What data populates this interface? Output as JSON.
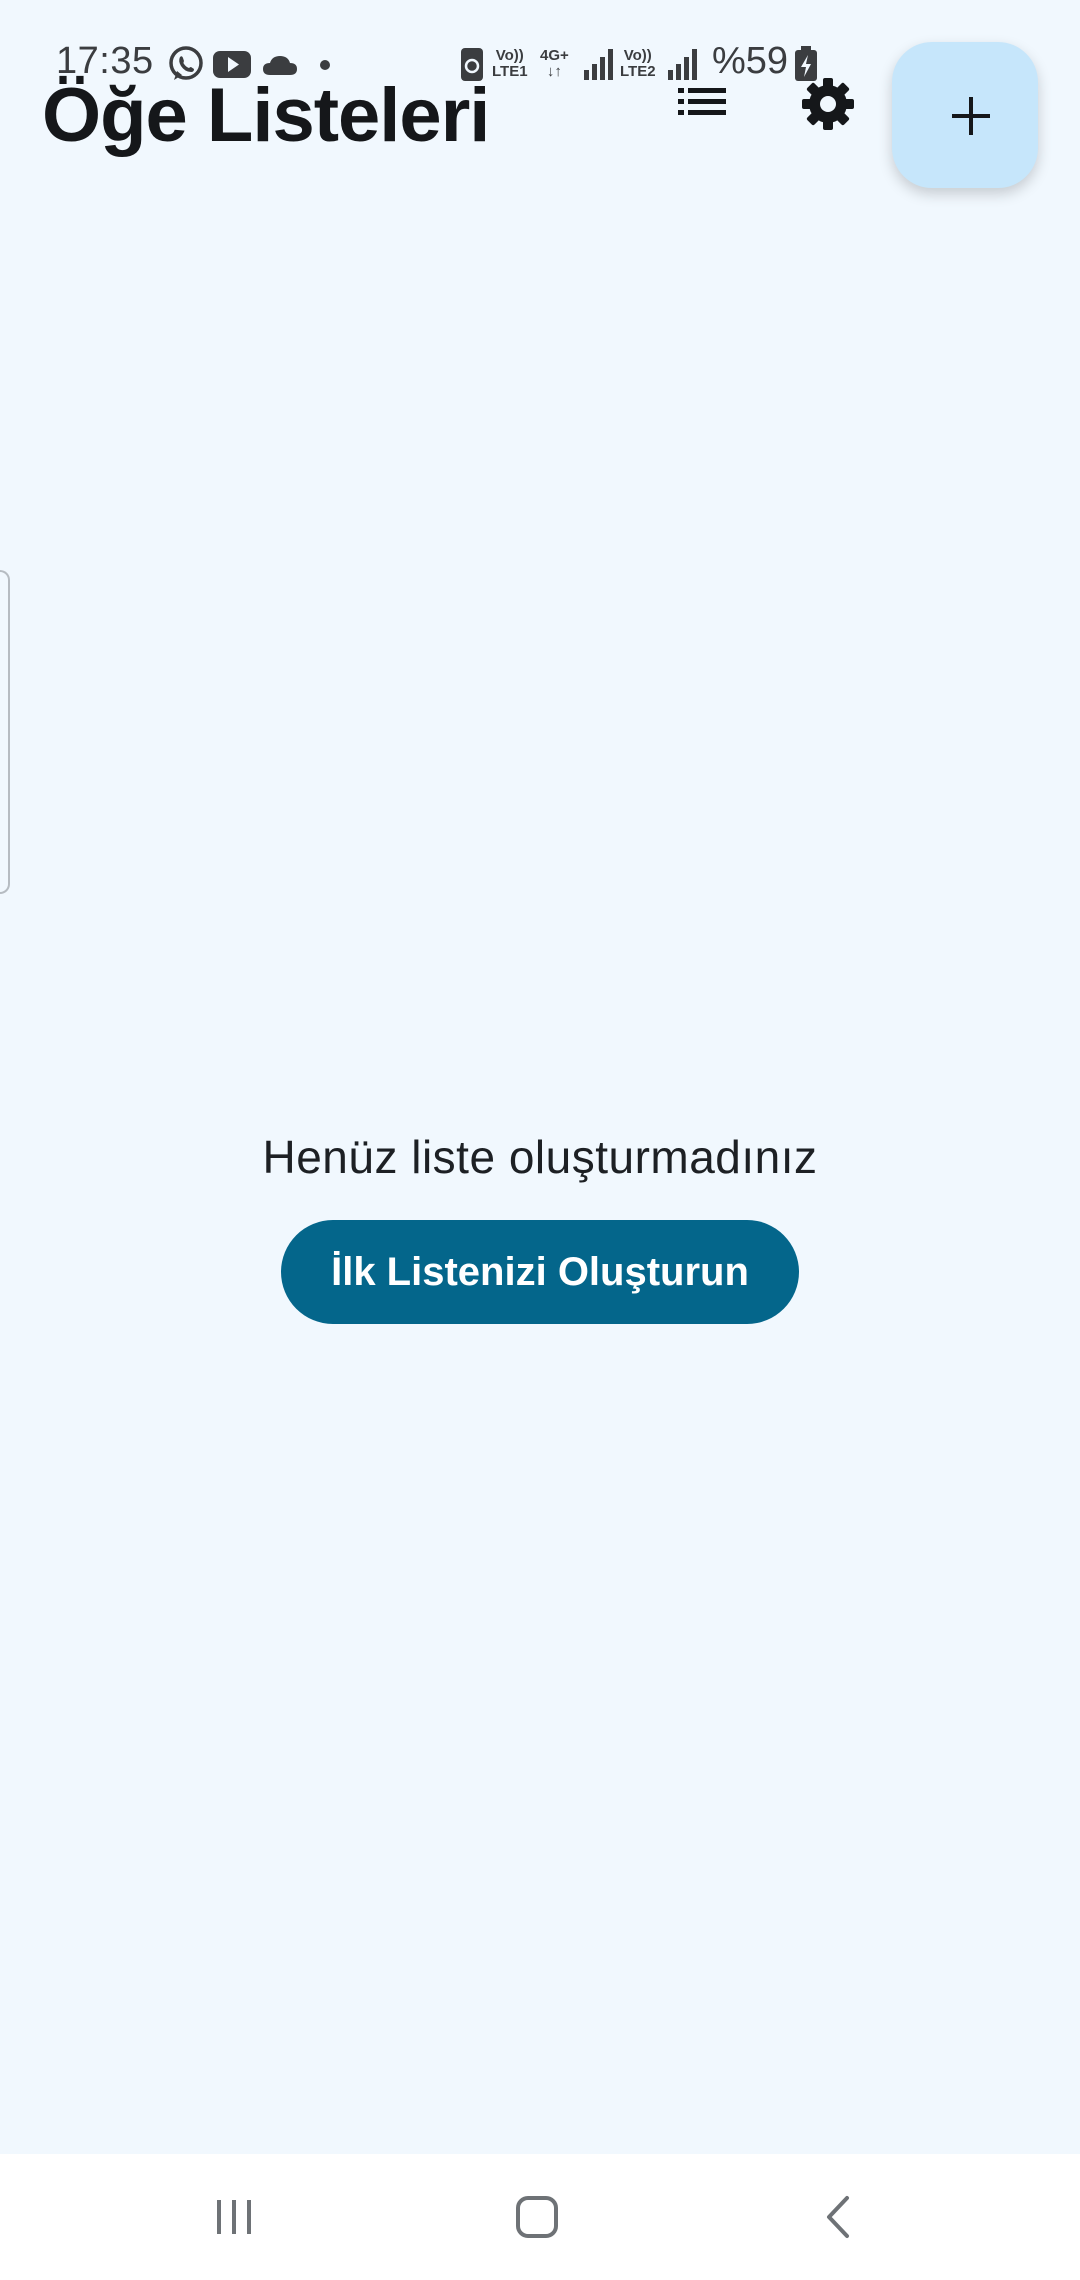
{
  "status_bar": {
    "time": "17:35",
    "battery": "%59",
    "sim1_top": "Vo))",
    "sim1_bottom": "LTE1",
    "net_type": "4G+",
    "sim2_top": "Vo))",
    "sim2_bottom": "LTE2",
    "notification_icons": [
      "whatsapp-icon",
      "youtube-icon",
      "cloud-icon",
      "dot-icon"
    ]
  },
  "header": {
    "title": "Öğe Listeleri",
    "actions": [
      "list-view-icon",
      "settings-gear-icon"
    ],
    "fab_icon": "plus-icon"
  },
  "empty_state": {
    "message": "Henüz liste oluşturmadınız",
    "button_label": "İlk Listenizi Oluşturun"
  },
  "nav_bar": {
    "buttons": [
      "recents-icon",
      "home-icon",
      "back-icon"
    ]
  },
  "colors": {
    "background": "#f1f8fe",
    "primary": "#04668b",
    "fab_background": "#c6e6fb",
    "text": "#17191c"
  }
}
